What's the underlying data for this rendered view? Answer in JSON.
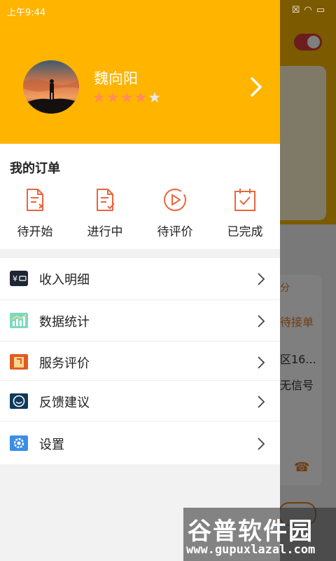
{
  "status_bar": {
    "time": "上午9:44"
  },
  "profile": {
    "name": "魏向阳",
    "rating_filled": 4,
    "rating_max": 5
  },
  "orders": {
    "title": "我的订单",
    "items": [
      {
        "label": "待开始",
        "icon": "document-x-icon"
      },
      {
        "label": "进行中",
        "icon": "document-edit-icon"
      },
      {
        "label": "待评价",
        "icon": "play-circle-icon"
      },
      {
        "label": "已完成",
        "icon": "calendar-check-icon"
      }
    ]
  },
  "menu": [
    {
      "label": "收入明细",
      "icon": "wallet-icon"
    },
    {
      "label": "数据统计",
      "icon": "chart-icon"
    },
    {
      "label": "服务评价",
      "icon": "review-icon"
    },
    {
      "label": "反馈建议",
      "icon": "feedback-icon"
    },
    {
      "label": "设置",
      "icon": "settings-icon"
    }
  ],
  "background": {
    "fen": "分",
    "status": "待接单",
    "address": "区16...",
    "signal": "无信号"
  },
  "watermark": {
    "brand": "谷普软件园",
    "url": "www.gupuxlazal.com"
  },
  "colors": {
    "accent": "#ffb400",
    "icon_orange": "#e8663d",
    "star": "#ff8c5a"
  }
}
